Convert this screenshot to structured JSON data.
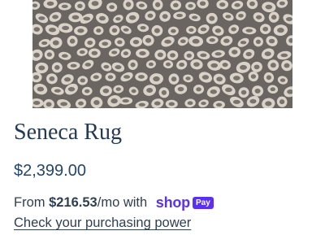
{
  "product": {
    "title": "Seneca Rug",
    "price": "$2,399.00",
    "image_icon": "rug-pattern-image"
  },
  "financing": {
    "prefix": "From ",
    "amount": "$216.53",
    "suffix": "/mo with ",
    "brand": "shop",
    "badge": "Pay",
    "link_text": "Check your purchasing power",
    "brand_color": "#5a31f4"
  }
}
